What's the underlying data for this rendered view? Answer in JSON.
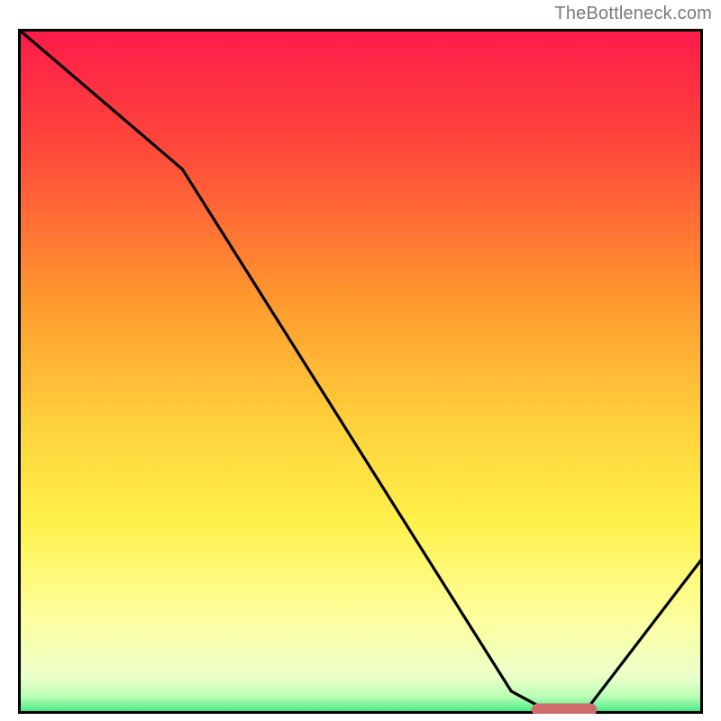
{
  "attribution": "TheBottleneck.com",
  "chart_data": {
    "type": "line",
    "title": "",
    "xlabel": "",
    "ylabel": "",
    "xlim": [
      0,
      100
    ],
    "ylim": [
      0,
      100
    ],
    "grid": false,
    "x": [
      0,
      24,
      72,
      77,
      83,
      100
    ],
    "values": [
      100,
      79.5,
      3.3,
      0.6,
      0.6,
      22.8
    ],
    "marker": {
      "x_start": 75,
      "x_end": 84.5,
      "y": 0.6,
      "color": "#cf6b6c"
    },
    "gradient_stops": [
      {
        "offset": 0,
        "color": "#ff1a4b"
      },
      {
        "offset": 0.18,
        "color": "#ff4a3a"
      },
      {
        "offset": 0.4,
        "color": "#ff9a2e"
      },
      {
        "offset": 0.58,
        "color": "#ffd23c"
      },
      {
        "offset": 0.72,
        "color": "#fff14b"
      },
      {
        "offset": 0.86,
        "color": "#fdff9e"
      },
      {
        "offset": 0.945,
        "color": "#ecffca"
      },
      {
        "offset": 0.975,
        "color": "#b9ffb4"
      },
      {
        "offset": 0.99,
        "color": "#6df094"
      },
      {
        "offset": 1.0,
        "color": "#1ce07a"
      }
    ],
    "border_color": "#000000"
  }
}
